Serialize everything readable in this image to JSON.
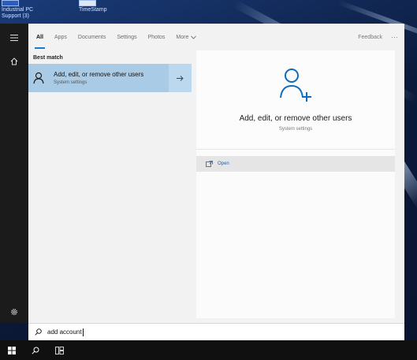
{
  "desktop": {
    "icons": [
      {
        "label_line1": "Industrial PC",
        "label_line2": "Support (3)"
      },
      {
        "label_line1": "TimeStamp"
      }
    ]
  },
  "rail": {
    "items": [
      {
        "icon": "hamburger-menu-icon"
      },
      {
        "icon": "home-icon"
      },
      {
        "icon": "settings-gear-icon"
      }
    ]
  },
  "tabs": {
    "items": [
      "All",
      "Apps",
      "Documents",
      "Settings",
      "Photos"
    ],
    "more_label": "More",
    "feedback_label": "Feedback",
    "ellipsis": "···"
  },
  "results": {
    "section_title": "Best match",
    "best_match": {
      "title": "Add, edit, or remove other users",
      "subtitle": "System settings"
    }
  },
  "preview": {
    "title": "Add, edit, or remove other users",
    "subtitle": "System settings",
    "actions": [
      {
        "label": "Open",
        "icon": "open-window-icon"
      }
    ]
  },
  "search": {
    "query": "add account",
    "icon": "search-icon"
  },
  "taskbar": {
    "items": [
      "windows-start-icon",
      "search-icon",
      "task-view-icon"
    ]
  },
  "colors": {
    "accent": "#1979ca",
    "selection": "#a9cbe6",
    "panel": "#f2f2f2"
  }
}
